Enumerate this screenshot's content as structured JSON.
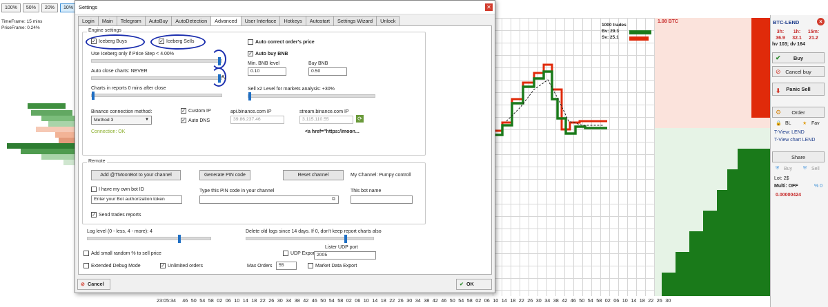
{
  "zoom": {
    "options": [
      "100%",
      "50%",
      "20%",
      "10%"
    ],
    "active": "10%"
  },
  "left_info": {
    "timeframe": "TimeFrame: 15 mins",
    "priceframe": "PriceFrame: 0.24%"
  },
  "time_axis": [
    "23:05:34",
    "46",
    "50",
    "54",
    "58",
    "02",
    "06",
    "10",
    "14",
    "18",
    "22",
    "26",
    "30",
    "34",
    "38",
    "42",
    "46",
    "50",
    "54",
    "58",
    "02",
    "06",
    "10",
    "14",
    "18",
    "22",
    "26",
    "30",
    "34",
    "38",
    "42",
    "46",
    "50",
    "54",
    "58",
    "02",
    "06",
    "10",
    "14",
    "18",
    "22",
    "26",
    "30",
    "34",
    "38",
    "42",
    "46",
    "50",
    "54",
    "58",
    "02",
    "06",
    "10",
    "14",
    "18",
    "22",
    "26",
    "30"
  ],
  "trades_box": {
    "title": "1000 trades",
    "bv": "Bv: 29.3",
    "sv": "Sv: 25.1"
  },
  "depth_price": "1.08 BTC",
  "right_panel": {
    "pair": "BTC-LEND",
    "stats_head": [
      "3h:",
      "1h:",
      "15m:"
    ],
    "stats_vals": [
      "36.9",
      "32.1",
      "21.2"
    ],
    "hv": "hv 103; dv 164",
    "buy": "Buy",
    "cancel_buy": "Cancel buy",
    "panic_sell": "Panic Sell",
    "order": "Order",
    "bl": "BL",
    "fav": "Fav",
    "tview": "T-View: LEND",
    "tview_chart": "T-View chart LEND",
    "share": "Share",
    "buy_small": "Buy",
    "sell_small": "Sell",
    "lot": "Lot: 2$",
    "multi": "Multi: OFF",
    "pct": "% 0",
    "price": "0.00000424"
  },
  "dialog": {
    "title": "Settings",
    "tabs": [
      "Login",
      "Main",
      "Telegram",
      "AutoBuy",
      "AutoDetection",
      "Advanced",
      "User Interface",
      "Hotkeys",
      "Autostart",
      "Settings Wizard",
      "Unlock"
    ],
    "active_tab": "Advanced",
    "engine_title": "Engine settings",
    "iceberg_buys": "Iceberg Buys",
    "iceberg_sells": "Iceberg Sells",
    "use_iceberg": "Use Iceberg only if Price Step < 4.00%",
    "auto_close": "Auto close charts: NEVER",
    "charts_in_reports": "Charts in reports 0 mins after close",
    "auto_correct": "Auto correct order's price",
    "auto_buy_bnb": "Auto buy BNB",
    "min_bnb_label": "Min. BNB level",
    "min_bnb_value": "0.10",
    "buy_bnb_label": "Buy BNB",
    "buy_bnb_value": "0.50",
    "sell_x2": "Sell x2 Level for markets analysis: +30%",
    "conn_method_label": "Binance connection method:",
    "conn_method_value": "Method 3",
    "custom_ip": "Custom IP",
    "auto_dns": "Auto DNS",
    "api_label": "api.binance.com IP",
    "api_value": "39.86.237.46",
    "stream_label": "stream.binance.com IP",
    "stream_value": "3.115.110.55",
    "connection": "Connection: OK",
    "href_text": "<a href=\"https://moon...",
    "remote_title": "Remote",
    "add_bot": "Add @TMoonBot to your channel",
    "gen_pin": "Generate PIN code",
    "reset_channel": "Reset channel",
    "my_channel": "My Channel: Pumpy controll",
    "own_bot": "I have my own bot ID",
    "token_placeholder": "Enter your Bot authorization token",
    "type_pin": "Type this PIN code in your channel",
    "bot_name": "This bot name",
    "send_reports": "Send trades reports",
    "log_level": "Log level (0 - less, 4 - more): 4",
    "delete_logs": "Delete old logs since 14 days. If 0, don't keep report charts also",
    "add_random": "Add small random % to sell price",
    "udp_export": "UDP Export",
    "udp_port_label": "Lister UDP port",
    "udp_port_value": "2005",
    "extended_debug": "Extended Debug Mode",
    "unlimited_orders": "Unlimited orders",
    "max_orders_label": "Max Orders",
    "max_orders_value": "55",
    "market_export": "Market Data Export",
    "cancel": "Cancel",
    "ok": "OK"
  },
  "colors": {
    "buy_green": "#1a7a1a",
    "sell_red": "#e02a0a",
    "pink": "#fbe3dc",
    "accent_blue": "#1f6fc4"
  }
}
